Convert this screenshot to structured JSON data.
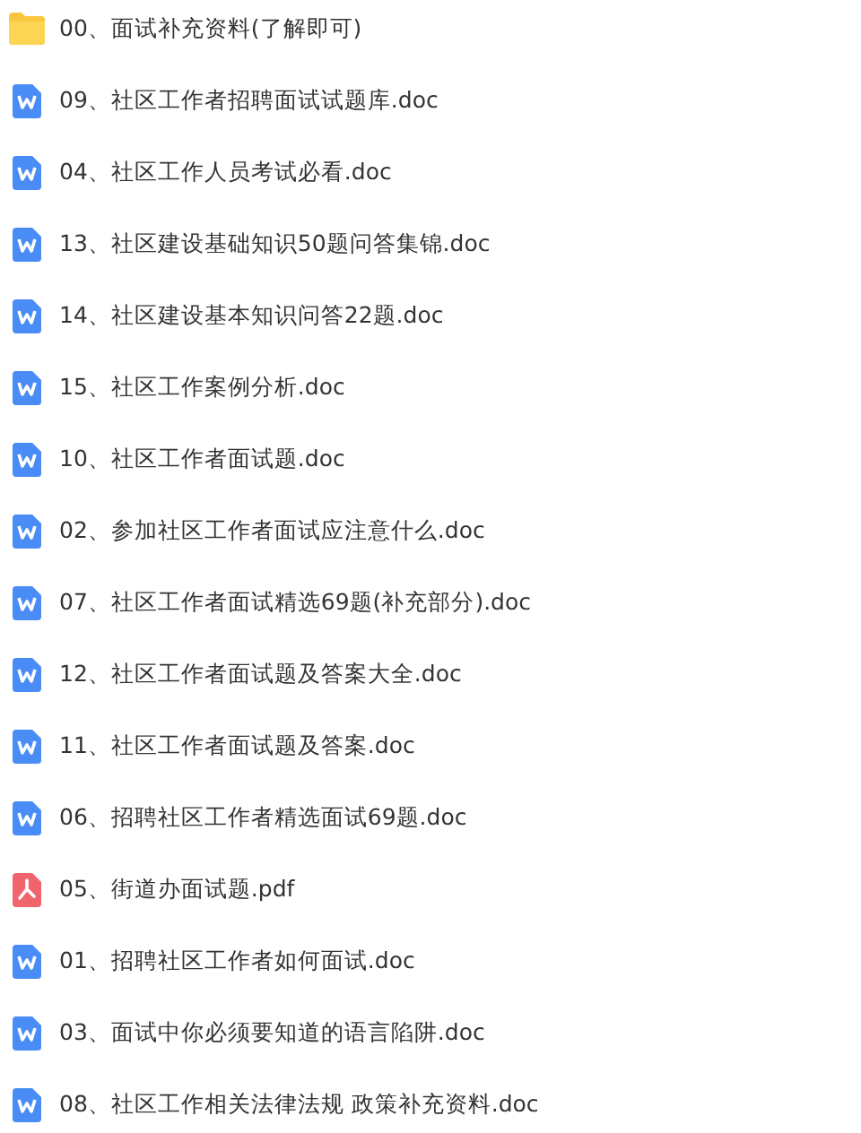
{
  "files": [
    {
      "kind": "folder",
      "name": "00、面试补充资料(了解即可)"
    },
    {
      "kind": "doc",
      "name": "09、社区工作者招聘面试试题库.doc"
    },
    {
      "kind": "doc",
      "name": "04、社区工作人员考试必看.doc"
    },
    {
      "kind": "doc",
      "name": "13、社区建设基础知识50题问答集锦.doc"
    },
    {
      "kind": "doc",
      "name": "14、社区建设基本知识问答22题.doc"
    },
    {
      "kind": "doc",
      "name": "15、社区工作案例分析.doc"
    },
    {
      "kind": "doc",
      "name": "10、社区工作者面试题.doc"
    },
    {
      "kind": "doc",
      "name": "02、参加社区工作者面试应注意什么.doc"
    },
    {
      "kind": "doc",
      "name": "07、社区工作者面试精选69题(补充部分).doc"
    },
    {
      "kind": "doc",
      "name": "12、社区工作者面试题及答案大全.doc"
    },
    {
      "kind": "doc",
      "name": "11、社区工作者面试题及答案.doc"
    },
    {
      "kind": "doc",
      "name": "06、招聘社区工作者精选面试69题.doc"
    },
    {
      "kind": "pdf",
      "name": "05、街道办面试题.pdf"
    },
    {
      "kind": "doc",
      "name": "01、招聘社区工作者如何面试.doc"
    },
    {
      "kind": "doc",
      "name": "03、面试中你必须要知道的语言陷阱.doc"
    },
    {
      "kind": "doc",
      "name": "08、社区工作相关法律法规 政策补充资料.doc"
    }
  ]
}
